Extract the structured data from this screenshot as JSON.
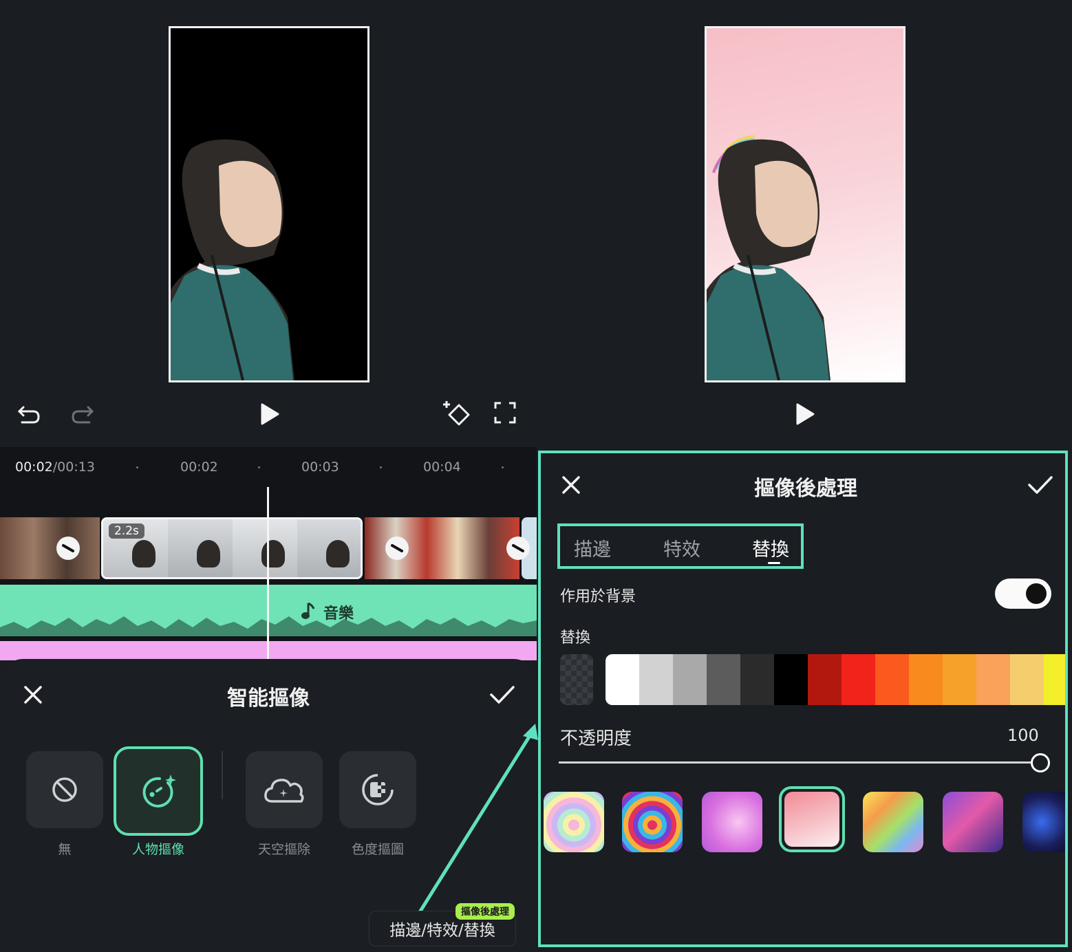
{
  "editor": {
    "timeline": {
      "current_time": "00:02",
      "total_time": "/00:13",
      "markers": [
        "00:02",
        "00:03",
        "00:04"
      ],
      "clip_duration": "2.2s",
      "music_label": "音樂"
    },
    "smart_cutout": {
      "title": "智能摳像",
      "options": [
        {
          "label": "無",
          "selected": false
        },
        {
          "label": "人物摳像",
          "selected": true
        },
        {
          "label": "天空摳除",
          "selected": false
        },
        {
          "label": "色度摳圖",
          "selected": false
        }
      ]
    },
    "callout": {
      "text": "描邊/特效/替換",
      "badge": "摳像後處理"
    }
  },
  "post_processing": {
    "title": "摳像後處理",
    "tabs": [
      {
        "label": "描邊",
        "active": false
      },
      {
        "label": "特效",
        "active": false
      },
      {
        "label": "替換",
        "active": true
      }
    ],
    "apply_background_label": "作用於背景",
    "apply_background_on": true,
    "replace_label": "替換",
    "colors": [
      "#ffffff",
      "#d2d2d2",
      "#a9a9a9",
      "#5c5c5c",
      "#2b2b2b",
      "#000000",
      "#b3180f",
      "#f2231b",
      "#fb5a1e",
      "#f98a1e",
      "#f6a12a",
      "#f8a25a",
      "#f6cd6d",
      "#f3ef2a"
    ],
    "opacity_label": "不透明度",
    "opacity_value": "100",
    "templates": [
      "pastel-heart",
      "rainbow-heart",
      "pink-swirl",
      "pink-gradient",
      "rainbow-blur",
      "cheers-sticker",
      "neon-stage"
    ],
    "selected_template": "pink-gradient"
  },
  "accent_color": "#5fe0b0"
}
